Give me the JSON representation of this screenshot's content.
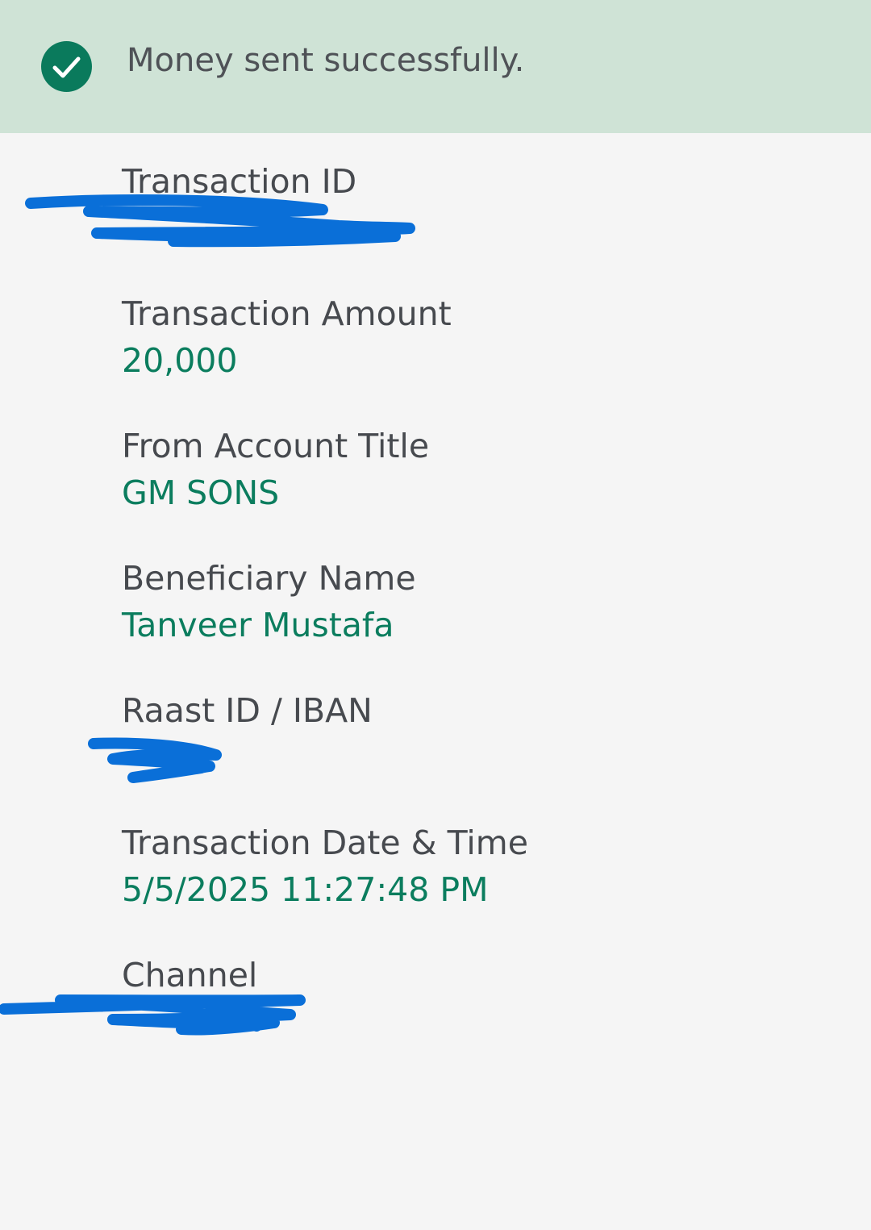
{
  "banner": {
    "icon": "check-circle-icon",
    "message": "Money sent successfully.",
    "background_color": "#cfe3d6",
    "icon_color": "#0a7a5c"
  },
  "details": {
    "transaction_id": {
      "label": "Transaction ID",
      "value": ""
    },
    "amount": {
      "label": "Transaction Amount",
      "value": "20,000"
    },
    "from_account": {
      "label": "From Account Title",
      "value": "GM SONS"
    },
    "beneficiary": {
      "label": "Beneficiary Name",
      "value": "Tanveer Mustafa"
    },
    "raast_id": {
      "label": "Raast ID / IBAN",
      "value": ""
    },
    "date_time": {
      "label": "Transaction Date & Time",
      "value": "5/5/2025 11:27:48 PM"
    },
    "channel": {
      "label": "Channel",
      "value": ""
    }
  },
  "colors": {
    "value_text": "#0b7d5e",
    "label_text": "#474a4f",
    "redaction": "#0a6fd8"
  }
}
